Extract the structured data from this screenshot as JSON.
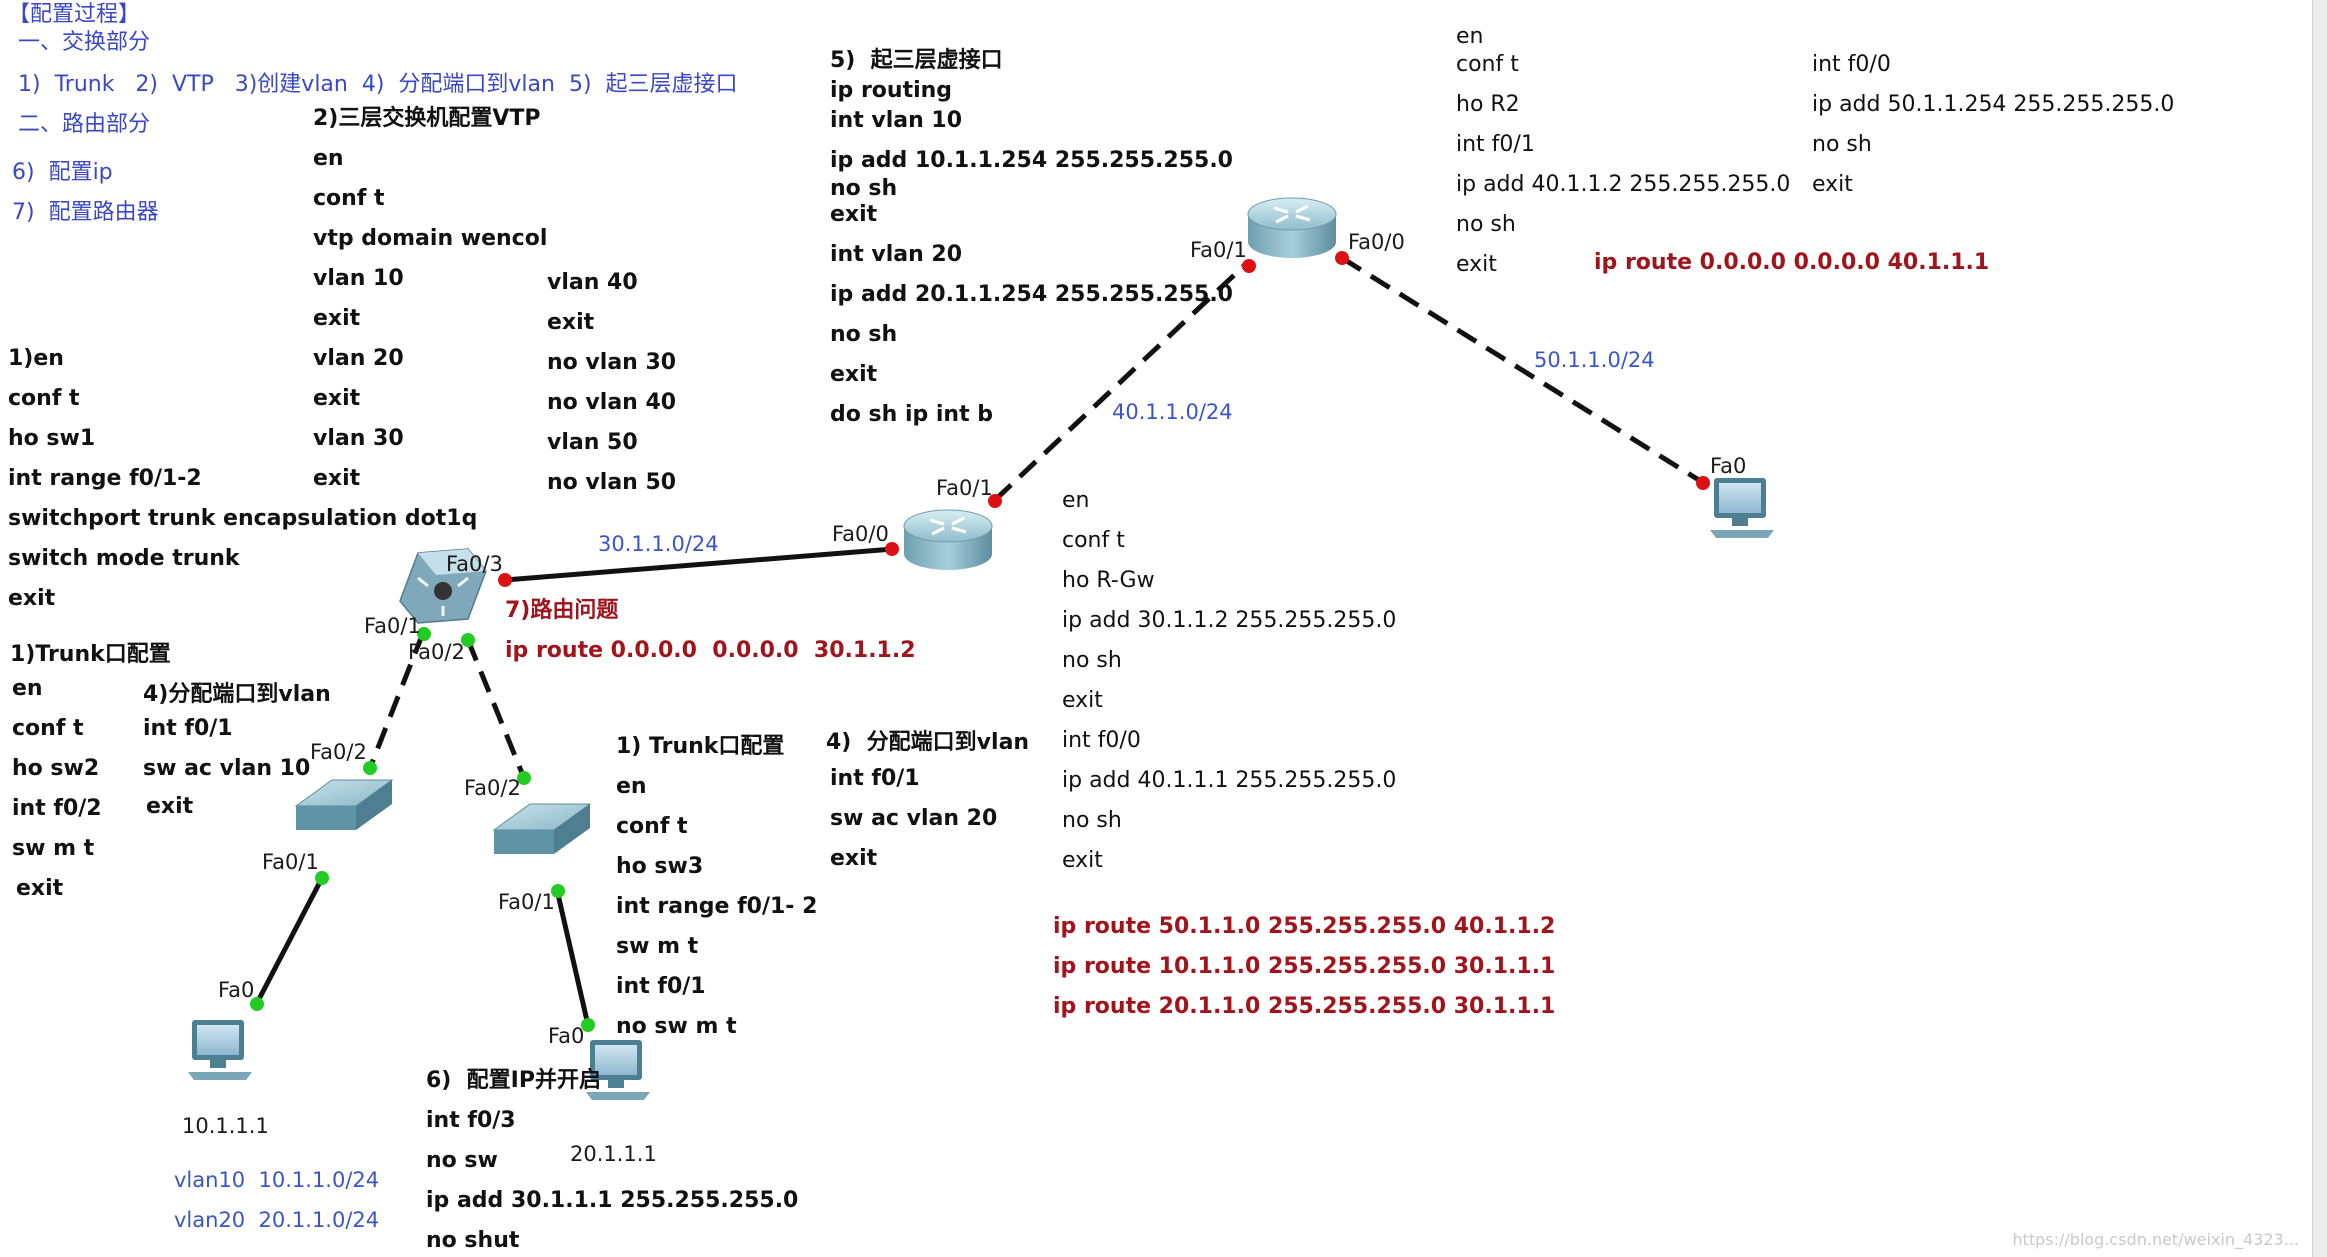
{
  "colors": {
    "text": "#111111",
    "blue": "#3a48c8",
    "red": "#a0141c",
    "link_green": "#22cc22",
    "link_red": "#dd1111"
  },
  "outline": {
    "title": "【配置过程】",
    "section1": "一、交换部分",
    "steps1": "1)  Trunk   2)  VTP   3)创建vlan  4)  分配端口到vlan  5)  起三层虚接口",
    "section2": "二、路由部分",
    "step6": "6)  配置ip",
    "step7": "7)  配置路由器"
  },
  "vtp_block": {
    "heading": "2)三层交换机配置VTP",
    "col1": [
      "en",
      "conf t",
      "vtp domain wencol",
      "vlan 10",
      "exit",
      "vlan 20",
      "exit",
      "vlan 30",
      "exit"
    ],
    "col2": [
      "vlan 40",
      "exit",
      "no vlan 30",
      "no vlan 40",
      "vlan 50",
      "no vlan 50"
    ]
  },
  "sw1_block": {
    "lines": [
      "1)en",
      "conf t",
      "ho sw1",
      "int range f0/1-2",
      "switchport trunk encapsulation dot1q",
      "switch mode trunk",
      "exit"
    ]
  },
  "sw2_block": {
    "heading": "1)Trunk口配置",
    "lines": [
      "en",
      "conf t",
      "ho sw2",
      "int f0/2",
      "sw m t",
      "exit"
    ],
    "heading2": "4)分配端口到vlan",
    "lines2": [
      "int f0/1",
      "sw ac vlan 10",
      "exit"
    ]
  },
  "sw3_block": {
    "heading": "1) Trunk口配置",
    "lines": [
      "en",
      "conf t",
      "ho sw3",
      "int range f0/1- 2",
      "sw m t",
      "int f0/1",
      "no sw m t"
    ],
    "heading2": "4)  分配端口到vlan",
    "lines2": [
      "int f0/1",
      "sw ac vlan 20",
      "exit"
    ]
  },
  "svi_block": {
    "heading": "5)  起三层虚接口",
    "lines": [
      "ip routing",
      "int vlan 10",
      "ip add 10.1.1.254 255.255.255.0",
      "no sh",
      "exit",
      "int vlan 20",
      "ip add 20.1.1.254 255.255.255.0",
      "no sh",
      "exit",
      "do sh ip int b"
    ]
  },
  "routing_issue": {
    "heading": "7)路由问题",
    "route": "ip route 0.0.0.0  0.0.0.0  30.1.1.2"
  },
  "ip_block": {
    "heading": "6)  配置IP并开启",
    "lines": [
      "int f0/3",
      "no sw",
      "ip add 30.1.1.1 255.255.255.0",
      "no shut"
    ]
  },
  "rgw_block": {
    "lines": [
      "en",
      "conf t",
      "ho R-Gw",
      "ip add 30.1.1.2 255.255.255.0",
      "no sh",
      "exit",
      "int f0/0",
      "ip add 40.1.1.1 255.255.255.0",
      "no sh",
      "exit"
    ],
    "routes": [
      "ip route 50.1.1.0 255.255.255.0 40.1.1.2",
      "ip route 10.1.1.0 255.255.255.0 30.1.1.1",
      "ip route 20.1.1.0 255.255.255.0 30.1.1.1"
    ]
  },
  "r2_block": {
    "col1": [
      "en",
      "conf t",
      "ho R2",
      "int f0/1",
      "ip add 40.1.1.2 255.255.255.0",
      "no sh",
      "exit"
    ],
    "col2": [
      "int f0/0",
      "ip add 50.1.1.254 255.255.255.0",
      "no sh",
      "exit"
    ],
    "route": "ip route 0.0.0.0 0.0.0.0 40.1.1.1"
  },
  "ports": {
    "ml_fa03": "Fa0/3",
    "ml_fa01": "Fa0/1",
    "ml_fa02": "Fa0/2",
    "sw2_fa02": "Fa0/2",
    "sw2_fa01": "Fa0/1",
    "sw3_fa02": "Fa0/2",
    "sw3_fa01": "Fa0/1",
    "pc1_fa0": "Fa0",
    "pc2_fa0": "Fa0",
    "pc3_fa0": "Fa0",
    "rgw_fa00": "Fa0/0",
    "rgw_fa01": "Fa0/1",
    "r2_fa01": "Fa0/1",
    "r2_fa00": "Fa0/0"
  },
  "networks": {
    "n30": "30.1.1.0/24",
    "n40": "40.1.1.0/24",
    "n50": "50.1.1.0/24"
  },
  "pcs": {
    "pc1_ip": "10.1.1.1",
    "pc2_ip": "20.1.1.1"
  },
  "vlan_legend": [
    "vlan10  10.1.1.0/24",
    "vlan20  20.1.1.0/24"
  ],
  "watermark": "https://blog.csdn.net/weixin_4323..."
}
